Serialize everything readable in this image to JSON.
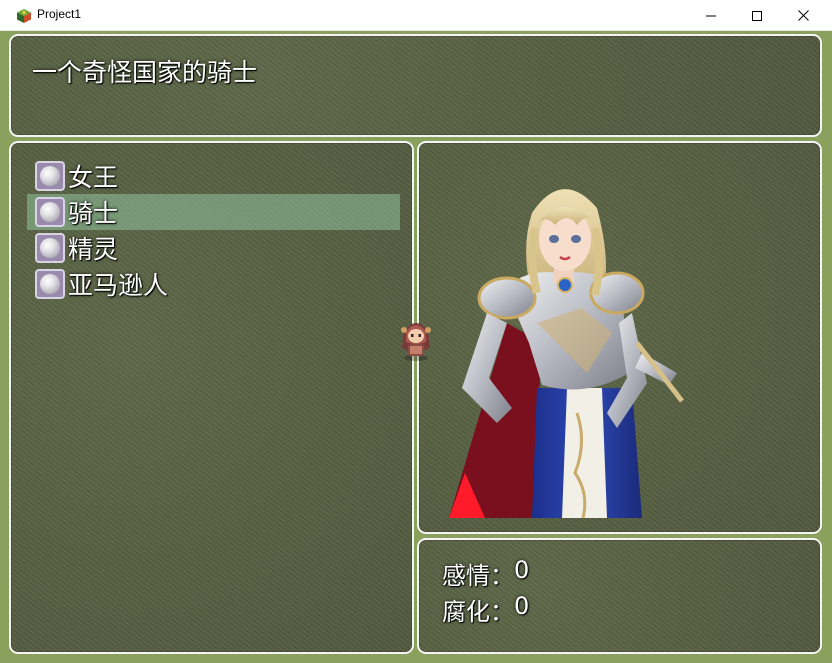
{
  "window": {
    "title": "Project1"
  },
  "header": {
    "text": "一个奇怪国家的骑士"
  },
  "menu": {
    "items": [
      {
        "label": "女王"
      },
      {
        "label": "骑士"
      },
      {
        "label": "精灵"
      },
      {
        "label": "亚马逊人"
      }
    ],
    "selected_index": 1
  },
  "stats": {
    "rows": [
      {
        "label": "感情：",
        "value": "0"
      },
      {
        "label": "腐化：",
        "value": "0"
      }
    ]
  },
  "colors": {
    "frame_bg": "#8aa05d",
    "panel_bg": "#555d40",
    "panel_border": "#f4f4f4",
    "cursor": "#9bd7af"
  },
  "icons": {
    "menu_item": "pearl-orb-icon",
    "app": "game-cube-icon"
  }
}
